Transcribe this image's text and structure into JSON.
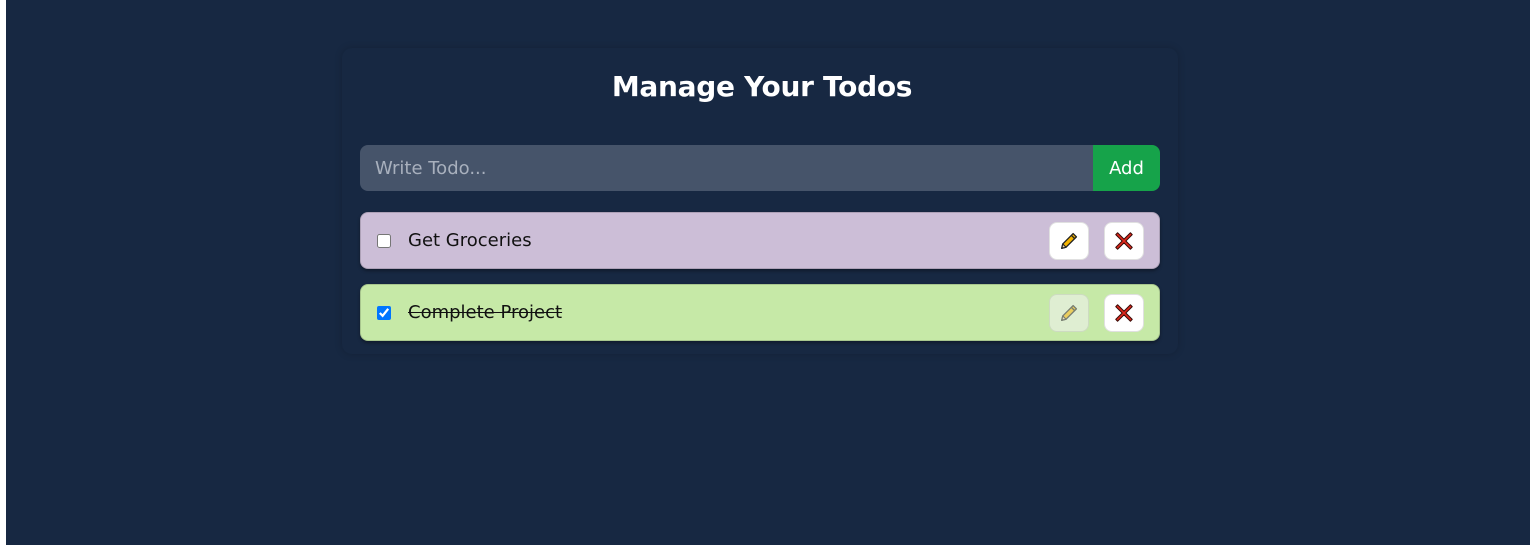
{
  "header": {
    "title": "Manage Your Todos"
  },
  "form": {
    "placeholder": "Write Todo...",
    "value": "",
    "add_label": "Add"
  },
  "todos": [
    {
      "text": "Get Groceries",
      "completed": false,
      "color": "#ccbed7",
      "edit_icon": "pencil-icon",
      "delete_icon": "cross-mark-icon"
    },
    {
      "text": "Complete Project",
      "completed": true,
      "color": "#c6e9a7",
      "edit_icon": "pencil-icon",
      "delete_icon": "cross-mark-icon"
    }
  ],
  "colors": {
    "background": "#172842",
    "input": "#46546a",
    "add_button": "#16a34a"
  }
}
